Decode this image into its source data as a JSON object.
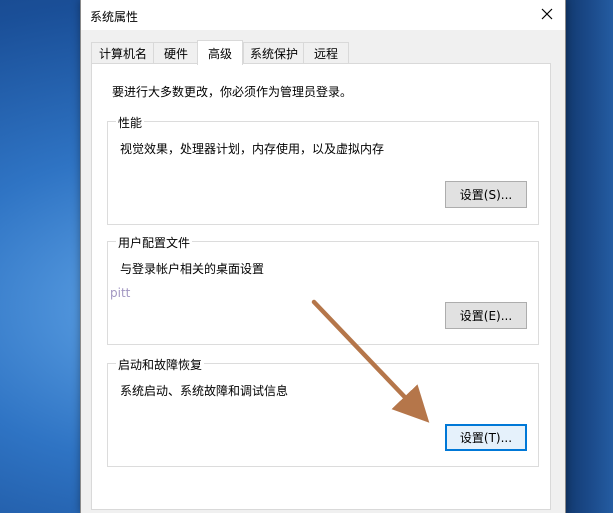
{
  "window": {
    "title": "系统属性"
  },
  "tabs": [
    {
      "label": "计算机名"
    },
    {
      "label": "硬件"
    },
    {
      "label": "高级",
      "active": true
    },
    {
      "label": "系统保护"
    },
    {
      "label": "远程"
    }
  ],
  "notice": "要进行大多数更改，你必须作为管理员登录。",
  "groups": {
    "performance": {
      "title": "性能",
      "description": "视觉效果，处理器计划，内存使用，以及虚拟内存",
      "button": "设置(S)..."
    },
    "user_profiles": {
      "title": "用户配置文件",
      "description": "与登录帐户相关的桌面设置",
      "button": "设置(E)..."
    },
    "startup_recovery": {
      "title": "启动和故障恢复",
      "description": "系统启动、系统故障和调试信息",
      "button": "设置(T)..."
    }
  },
  "overlay": {
    "watermark_text": "pitt",
    "arrow_color": "#b5764a"
  },
  "colors": {
    "focus_border": "#0078d7",
    "desktop_blue": "#2f74c4"
  }
}
